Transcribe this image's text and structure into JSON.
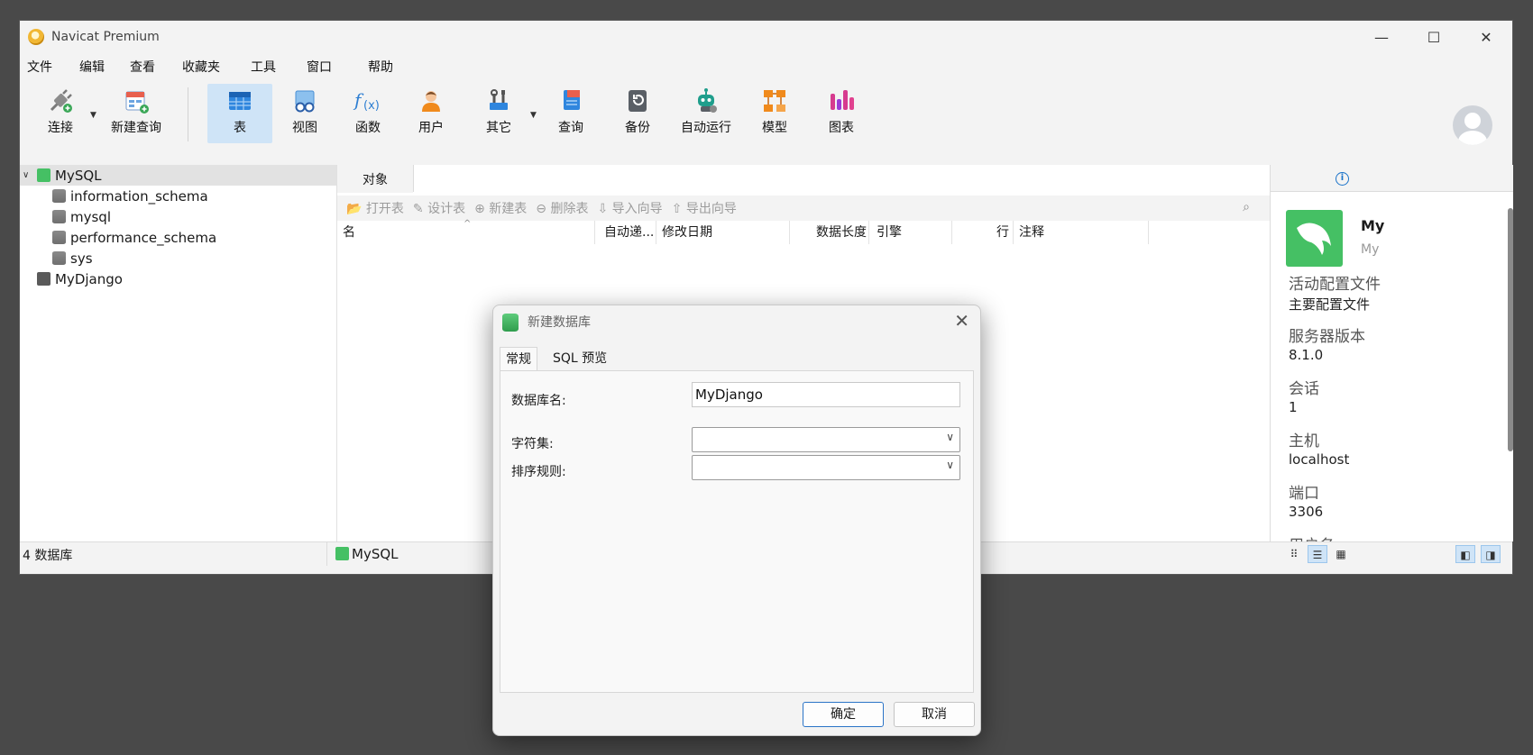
{
  "window": {
    "title": "Navicat Premium",
    "controls": [
      "—",
      "☐",
      "✕"
    ]
  },
  "menu": [
    "文件",
    "编辑",
    "查看",
    "收藏夹",
    "工具",
    "窗口",
    "帮助"
  ],
  "toolbar": {
    "connect": "连接",
    "new_query": "新建查询",
    "table": "表",
    "view": "视图",
    "function": "函数",
    "user": "用户",
    "other": "其它",
    "query": "查询",
    "backup": "备份",
    "auto_run": "自动运行",
    "model": "模型",
    "chart": "图表",
    "active": "表"
  },
  "sidebar": {
    "connections": [
      {
        "name": "MySQL",
        "expanded": true,
        "selected": true,
        "databases": [
          "information_schema",
          "mysql",
          "performance_schema",
          "sys"
        ]
      },
      {
        "name": "MyDjango",
        "expanded": false,
        "selected": false
      }
    ]
  },
  "main": {
    "tab": "对象",
    "actions": [
      "打开表",
      "设计表",
      "新建表",
      "删除表",
      "导入向导",
      "导出向导"
    ],
    "columns": [
      "名",
      "自动递...",
      "修改日期",
      "数据长度",
      "引擎",
      "行",
      "注释"
    ]
  },
  "info": {
    "name": "My",
    "sub": "My",
    "fields": [
      {
        "label": "活动配置文件",
        "value": "主要配置文件"
      },
      {
        "label": "服务器版本",
        "value": "8.1.0"
      },
      {
        "label": "会话",
        "value": "1"
      },
      {
        "label": "主机",
        "value": "localhost"
      },
      {
        "label": "端口",
        "value": "3306"
      },
      {
        "label": "用户名",
        "value": ""
      }
    ]
  },
  "status": {
    "count": "4 数据库",
    "connection": "MySQL"
  },
  "dialog": {
    "title": "新建数据库",
    "tabs": [
      "常规",
      "SQL 预览"
    ],
    "db_name_label": "数据库名:",
    "db_name_value": "MyDjango",
    "charset_label": "字符集:",
    "charset_value": "",
    "collation_label": "排序规则:",
    "collation_value": "",
    "ok": "确定",
    "cancel": "取消"
  },
  "colors": {
    "accent": "#2b74c7",
    "active_bg": "#cfe4f7",
    "mysql_green": "#45c064"
  }
}
